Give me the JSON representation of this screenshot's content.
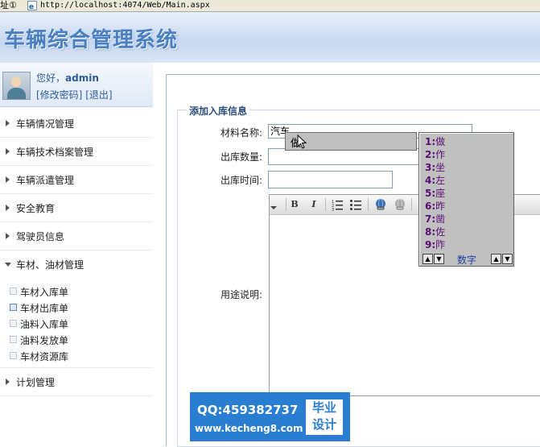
{
  "browser": {
    "address_label": "址①",
    "url": "http://localhost:4074/Web/Main.aspx"
  },
  "header": {
    "title": "车辆综合管理系统"
  },
  "user": {
    "greeting": "您好，",
    "name": "admin",
    "change_password": "[修改密码]",
    "logout": "[退出]"
  },
  "sidebar": {
    "menu": [
      {
        "label": "车辆情况管理"
      },
      {
        "label": "车辆技术档案管理"
      },
      {
        "label": "车辆派遣管理"
      },
      {
        "label": "安全教育"
      },
      {
        "label": "驾驶员信息"
      },
      {
        "label": "车材、油材管理"
      }
    ],
    "submenu": [
      {
        "label": "车材入库单"
      },
      {
        "label": "车材出库单"
      },
      {
        "label": "油料入库单"
      },
      {
        "label": "油料发放单"
      },
      {
        "label": "车材资源库"
      }
    ],
    "plan": {
      "label": "计划管理"
    }
  },
  "form": {
    "legend": "添加入库信息",
    "material_label": "材料名称:",
    "material_value": "汽车",
    "quantity_label": "出库数量:",
    "quantity_value": "",
    "time_label": "出库时间:",
    "time_value": "",
    "usage_label": "用途说明:"
  },
  "editor": {
    "toolbar": [
      "B",
      "I",
      "ordered-list",
      "unordered-list",
      "link",
      "unlink"
    ]
  },
  "ime": {
    "composition": "做",
    "candidates": [
      {
        "n": "1:",
        "c": "做"
      },
      {
        "n": "2:",
        "c": "作"
      },
      {
        "n": "3:",
        "c": "坐"
      },
      {
        "n": "4:",
        "c": "左"
      },
      {
        "n": "5:",
        "c": "座"
      },
      {
        "n": "6:",
        "c": "昨"
      },
      {
        "n": "7:",
        "c": "凿"
      },
      {
        "n": "8:",
        "c": "佐"
      },
      {
        "n": "9:",
        "c": "阼"
      }
    ],
    "mode": "数字"
  },
  "banner": {
    "qq": "QQ:459382737",
    "site": "www.kecheng8.com",
    "badge_line1": "毕业",
    "badge_line2": "设计"
  }
}
